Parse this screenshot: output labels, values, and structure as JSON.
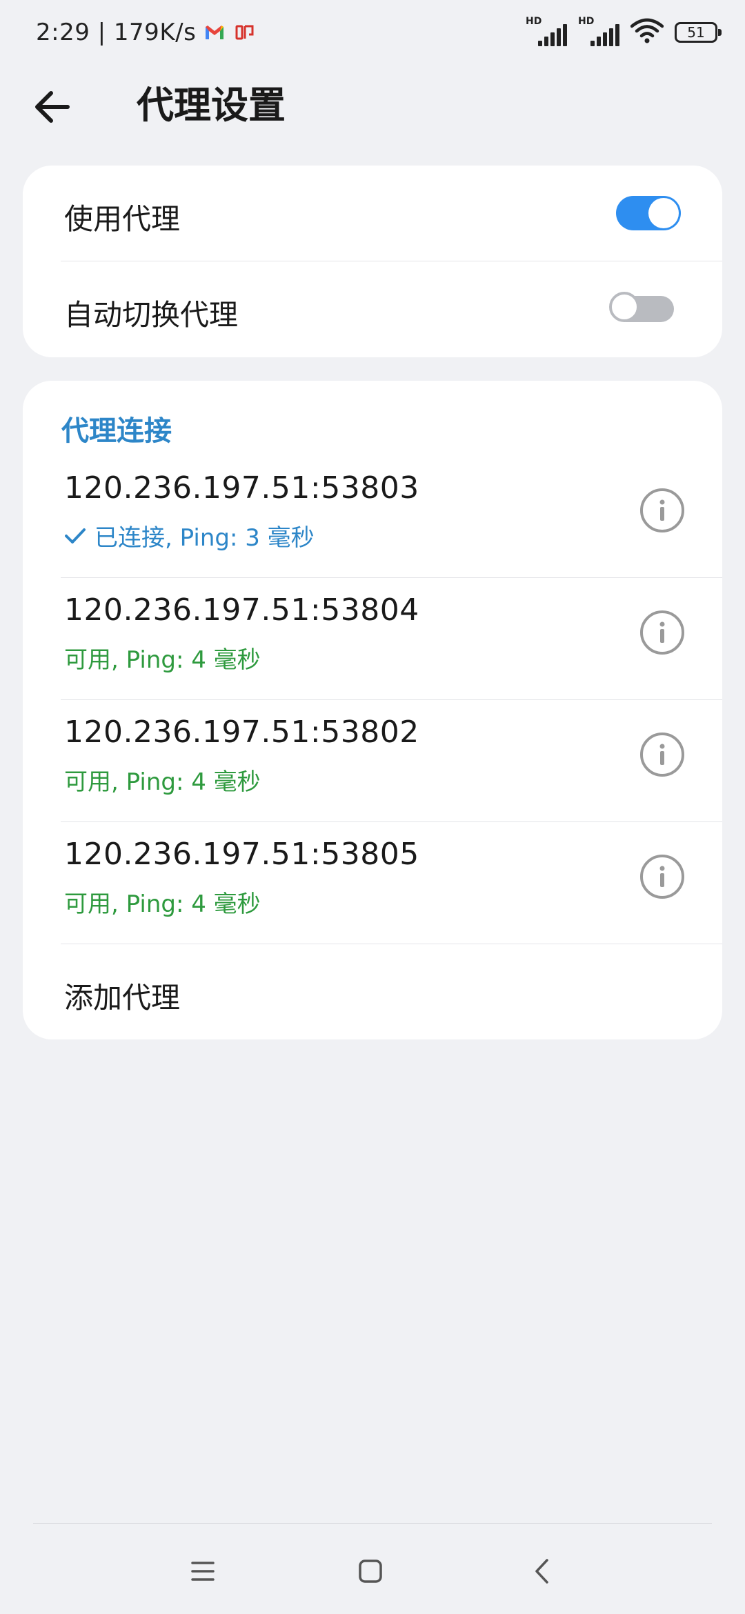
{
  "status_bar": {
    "time_speed": "2:29 | 179K/s",
    "battery": "51",
    "signal_1_label": "HD",
    "signal_2_label": "HD"
  },
  "header": {
    "title": "代理设置"
  },
  "settings": {
    "use_proxy_label": "使用代理",
    "use_proxy_on": true,
    "auto_switch_label": "自动切换代理",
    "auto_switch_on": false
  },
  "connections": {
    "section_title": "代理连接",
    "items": [
      {
        "address": "120.236.197.51:53803",
        "status": "已连接, Ping: 3 毫秒"
      },
      {
        "address": "120.236.197.51:53804",
        "status": "可用, Ping: 4 毫秒"
      },
      {
        "address": "120.236.197.51:53802",
        "status": "可用, Ping: 4 毫秒"
      },
      {
        "address": "120.236.197.51:53805",
        "status": "可用, Ping: 4 毫秒"
      }
    ],
    "add_label": "添加代理"
  },
  "colors": {
    "accent_blue": "#2d86c8",
    "toggle_on": "#2e8ef0",
    "available_green": "#2e9a3e",
    "background": "#f0f1f4"
  }
}
